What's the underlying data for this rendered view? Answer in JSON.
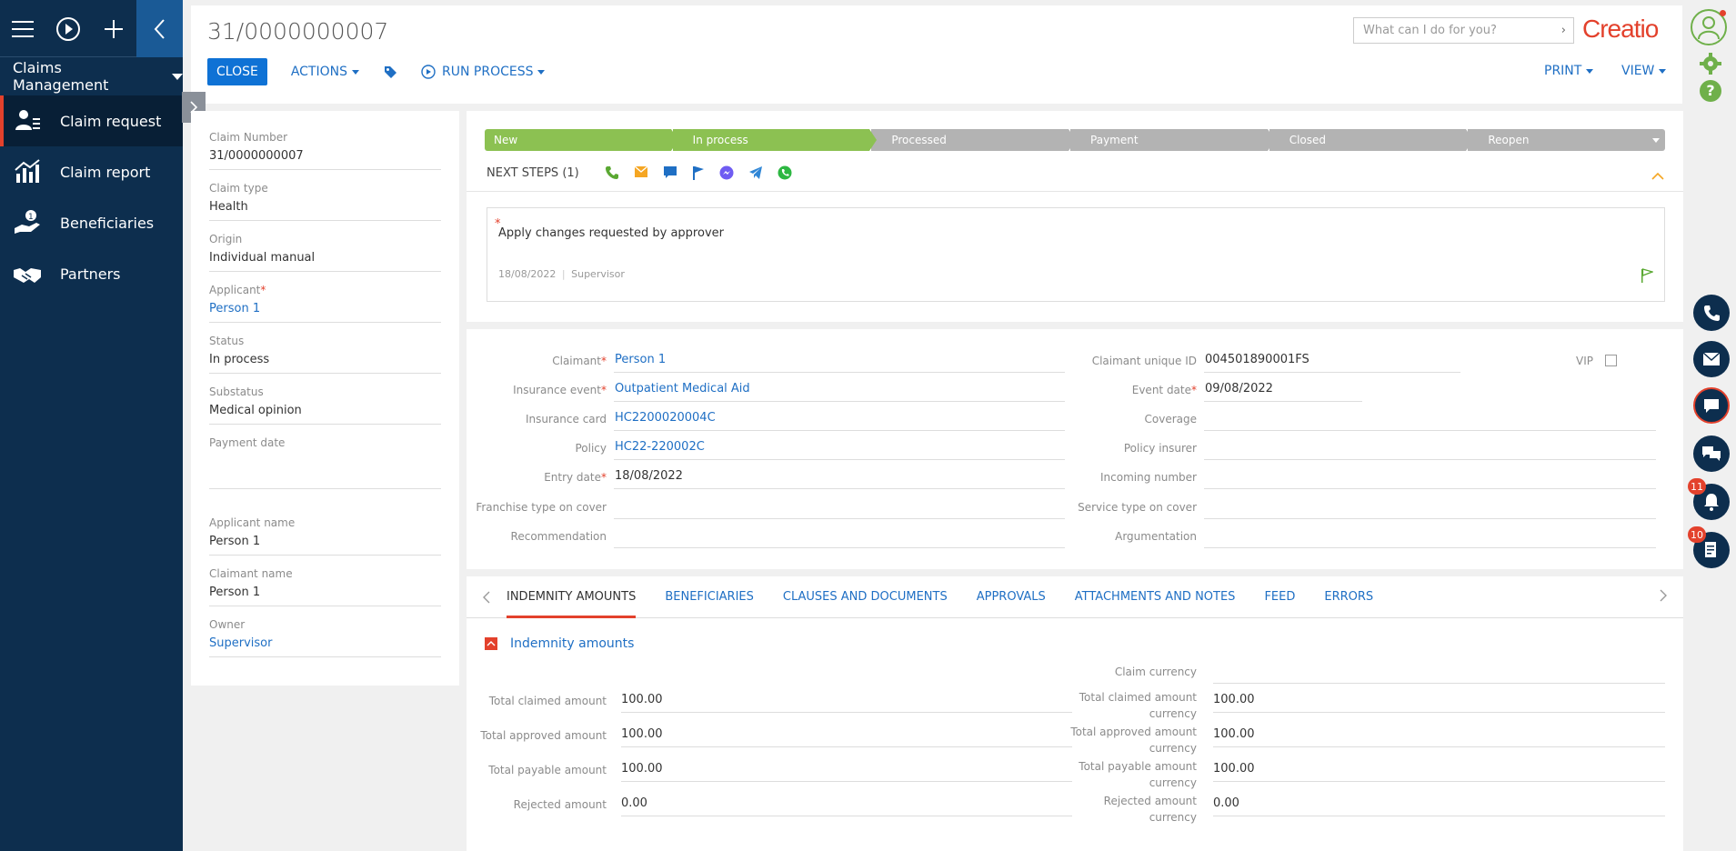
{
  "nav": {
    "workplace": "Claims Management",
    "items": [
      {
        "label": "Claim request",
        "icon": "person-list-icon"
      },
      {
        "label": "Claim report",
        "icon": "chart-icon"
      },
      {
        "label": "Beneficiaries",
        "icon": "hand-money-icon"
      },
      {
        "label": "Partners",
        "icon": "handshake-icon"
      }
    ]
  },
  "header": {
    "title": "31/0000000007",
    "close_label": "CLOSE",
    "actions_label": "ACTIONS",
    "run_process_label": "RUN PROCESS",
    "print_label": "PRINT",
    "view_label": "VIEW",
    "search_placeholder": "What can I do for you?",
    "logo": "Creatio"
  },
  "left_panel": {
    "fields": [
      {
        "label": "Claim Number",
        "value": "31/0000000007"
      },
      {
        "label": "Claim type",
        "value": "Health"
      },
      {
        "label": "Origin",
        "value": "Individual manual"
      },
      {
        "label": "Applicant",
        "value": "Person 1",
        "required": "*"
      },
      {
        "label": "Status",
        "value": "In process"
      },
      {
        "label": "Substatus",
        "value": "Medical opinion"
      },
      {
        "label": "Payment date",
        "value": ""
      },
      {
        "label": "Applicant name",
        "value": "Person 1"
      },
      {
        "label": "Claimant name",
        "value": "Person 1"
      },
      {
        "label": "Owner",
        "value": "Supervisor"
      }
    ]
  },
  "stages": [
    "New",
    "In process",
    "Processed",
    "Payment",
    "Closed",
    "Reopen"
  ],
  "next_steps": {
    "label": "NEXT STEPS (1)",
    "task_title": "Apply changes requested by approver",
    "task_date": "18/08/2022",
    "task_owner": "Supervisor"
  },
  "fields": {
    "claimant": {
      "label": "Claimant",
      "value": "Person 1"
    },
    "insurance_event": {
      "label": "Insurance event",
      "value": "Outpatient Medical Aid"
    },
    "insurance_card": {
      "label": "Insurance card",
      "value": "HC2200020004C"
    },
    "policy": {
      "label": "Policy",
      "value": "HC22-220002C"
    },
    "entry_date": {
      "label": "Entry date",
      "value": "18/08/2022"
    },
    "franchise": {
      "label": "Franchise type on cover",
      "value": ""
    },
    "recommendation": {
      "label": "Recommendation",
      "value": ""
    },
    "claimant_uid": {
      "label": "Claimant unique ID",
      "value": "004501890001FS"
    },
    "vip": {
      "label": "VIP"
    },
    "event_date": {
      "label": "Event date",
      "value": "09/08/2022"
    },
    "coverage": {
      "label": "Coverage",
      "value": ""
    },
    "policy_insurer": {
      "label": "Policy insurer",
      "value": ""
    },
    "incoming_number": {
      "label": "Incoming number",
      "value": ""
    },
    "service_type": {
      "label": "Service type on cover",
      "value": ""
    },
    "argumentation": {
      "label": "Argumentation",
      "value": ""
    }
  },
  "tabs": [
    "INDEMNITY AMOUNTS",
    "BENEFICIARIES",
    "CLAUSES AND DOCUMENTS",
    "APPROVALS",
    "ATTACHMENTS AND NOTES",
    "FEED",
    "ERRORS"
  ],
  "indemnity": {
    "section_title": "Indemnity amounts",
    "claim_currency_label": "Claim currency",
    "claim_currency_value": "",
    "left": [
      {
        "label": "Total claimed amount",
        "value": "100.00"
      },
      {
        "label": "Total approved amount",
        "value": "100.00"
      },
      {
        "label": "Total payable amount",
        "value": "100.00"
      },
      {
        "label": "Rejected amount",
        "value": "0.00"
      }
    ],
    "right": [
      {
        "label1": "Total claimed amount",
        "label2": "currency",
        "value": "100.00"
      },
      {
        "label1": "Total approved amount",
        "label2": "currency",
        "value": "100.00"
      },
      {
        "label1": "Total payable amount",
        "label2": "currency",
        "value": "100.00"
      },
      {
        "label1": "Rejected amount",
        "label2": "currency",
        "value": "0.00"
      }
    ]
  },
  "rail": {
    "notifications_count": "11",
    "feed_count": "10"
  },
  "colors": {
    "nav_bg": "#0d2e4e",
    "accent": "#e3412c",
    "primary": "#0f72d5",
    "stage_done": "#8cc152",
    "stage_todo": "#b3b3b3"
  }
}
